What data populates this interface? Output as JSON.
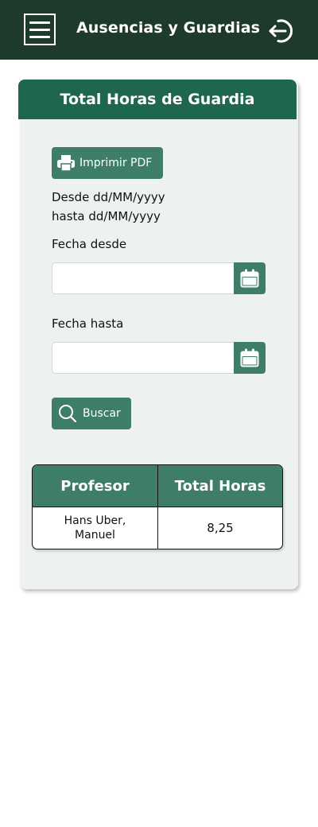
{
  "header": {
    "title": "Ausencias y Guardias",
    "menu_icon": "hamburger-menu-icon",
    "logout_icon": "logout-icon",
    "background_color": "#1e3a2d"
  },
  "card": {
    "title": "Total Horas de Guardia",
    "header_color": "#1f6650",
    "print_button": {
      "label": "Imprimir PDF",
      "icon": "printer-icon"
    },
    "date_hint_line1": "Desde dd/MM/yyyy",
    "date_hint_line2": "hasta dd/MM/yyyy",
    "fecha_desde": {
      "label": "Fecha desde",
      "value": "",
      "icon": "calendar-icon"
    },
    "fecha_hasta": {
      "label": "Fecha hasta",
      "value": "",
      "icon": "calendar-icon"
    },
    "search_button": {
      "label": "Buscar",
      "icon": "search-icon"
    },
    "accent_color": "#3f7e66"
  },
  "table": {
    "columns": [
      "Profesor",
      "Total Horas"
    ],
    "rows": [
      {
        "profesor": "Hans Uber, Manuel",
        "total_horas": "8,25"
      }
    ]
  }
}
